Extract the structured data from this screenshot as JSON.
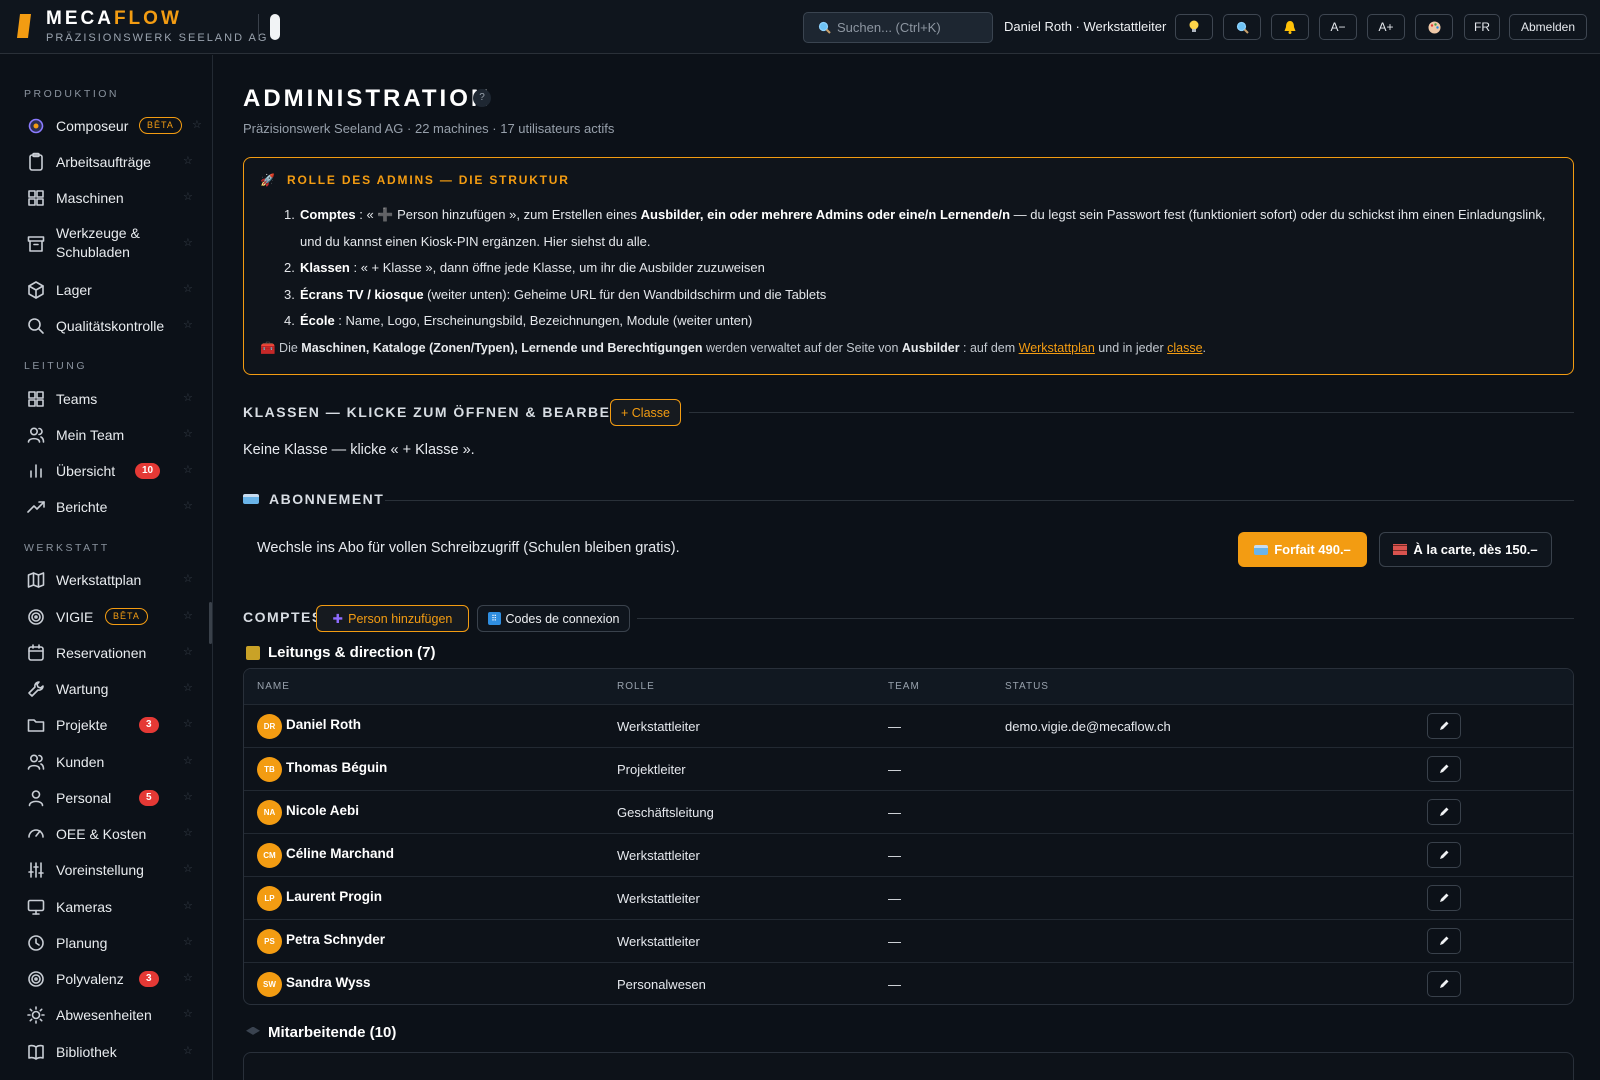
{
  "app": {
    "brand_a": "MECA",
    "brand_b": "FLOW",
    "subtitle": "PRÄZISIONSWERK SEELAND AG",
    "accent": "#f39c12"
  },
  "topbar": {
    "search_placeholder": "Suchen...  (Ctrl+K)",
    "user": "Daniel Roth · Werkstattleiter",
    "buttons": {
      "font_smaller": "A−",
      "font_larger": "A+",
      "lang": "FR",
      "logout": "Abmelden"
    }
  },
  "sidebar": {
    "sections": [
      "PRODUKTION",
      "LEITUNG",
      "WERKSTATT"
    ],
    "items": [
      {
        "label": "Composeur",
        "icon": "composer-icon",
        "badge": "BÊTA"
      },
      {
        "label": "Arbeitsaufträge",
        "icon": "clipboard-icon"
      },
      {
        "label": "Maschinen",
        "icon": "grid-icon"
      },
      {
        "label": "Werkzeuge &",
        "label2": "Schubladen",
        "icon": "archive-icon"
      },
      {
        "label": "Lager",
        "icon": "box-icon"
      },
      {
        "label": "Qualitätskontrolle",
        "icon": "search-icon"
      },
      {
        "label": "Teams",
        "icon": "grid-icon"
      },
      {
        "label": "Mein Team",
        "icon": "users-icon"
      },
      {
        "label": "Übersicht",
        "icon": "bar-chart-icon",
        "count": "10"
      },
      {
        "label": "Berichte",
        "icon": "trend-icon"
      },
      {
        "label": "Werkstattplan",
        "icon": "map-icon"
      },
      {
        "label": "VIGIE",
        "icon": "target-icon",
        "badge": "BÊTA"
      },
      {
        "label": "Reservationen",
        "icon": "calendar-icon"
      },
      {
        "label": "Wartung",
        "icon": "wrench-icon"
      },
      {
        "label": "Projekte",
        "icon": "folder-icon",
        "count": "3"
      },
      {
        "label": "Kunden",
        "icon": "users-icon"
      },
      {
        "label": "Personal",
        "icon": "user-icon",
        "count": "5"
      },
      {
        "label": "OEE & Kosten",
        "icon": "gauge-icon"
      },
      {
        "label": "Voreinstellung",
        "icon": "sliders-icon"
      },
      {
        "label": "Kameras",
        "icon": "monitor-icon"
      },
      {
        "label": "Planung",
        "icon": "clock-icon"
      },
      {
        "label": "Polyvalenz",
        "icon": "target-icon",
        "count": "3"
      },
      {
        "label": "Abwesenheiten",
        "icon": "sun-icon"
      },
      {
        "label": "Bibliothek",
        "icon": "book-icon"
      }
    ]
  },
  "page": {
    "title": "ADMINISTRATION",
    "help": "?",
    "subtitle": "Präzisionswerk Seeland AG · 22 machines · 17 utilisateurs actifs"
  },
  "info": {
    "title": "ROLLE DES ADMINS — DIE STRUKTUR",
    "items": [
      {
        "num": "1.",
        "b1": "Comptes",
        "t1": " : « ",
        "plus": "➕",
        "t2": " Person hinzufügen », zum Erstellen eines ",
        "b2": "Ausbilder, ein oder mehrere Admins oder eine/n Lernende/n",
        "t3": " — du legst sein Passwort fest (funktioniert sofort) oder du schickst ihm einen Einladungslink, und du kannst einen Kiosk-PIN ergänzen. Hier siehst du alle."
      },
      {
        "num": "2.",
        "b1": "Klassen",
        "t1": " : « + Klasse », dann öffne jede Klasse, um ihr die Ausbilder zuzuweisen"
      },
      {
        "num": "3.",
        "b1": "Écrans TV / kiosque",
        "t1": " (weiter unten): Geheime URL für den Wandbildschirm und die Tablets"
      },
      {
        "num": "4.",
        "b1": "École",
        "t1": " : Name, Logo, Erscheinungsbild, Bezeichnungen, Module (weiter unten)"
      }
    ],
    "foot": {
      "t1": " Die ",
      "b1": "Maschinen, Kataloge (Zonen/Typen), Lernende und Berechtigungen",
      "t2": " werden verwaltet auf der Seite von ",
      "b2": "Ausbilder",
      "t3": " : auf dem ",
      "link1": "Werkstattplan",
      "t4": " und in jeder ",
      "link2": "classe",
      "t5": "."
    }
  },
  "klassen": {
    "heading": "KLASSEN — KLICKE ZUM ÖFFNEN & BEARBEITEN",
    "add": "+ Classe",
    "empty": "Keine Klasse — klicke « + Klasse »."
  },
  "abo": {
    "heading": "ABONNEMENT",
    "text": "Wechsle ins Abo für vollen Schreibzugriff (Schulen bleiben gratis).",
    "primary": "Forfait 490.–",
    "secondary": "À la carte, dès 150.–"
  },
  "comptes": {
    "heading": "COMPTES",
    "add": "Person hinzufügen",
    "codes": "Codes de connexion",
    "group1": "Leitungs & direction (7)",
    "group2": "Mitarbeitende (10)",
    "columns": [
      "NAME",
      "ROLLE",
      "TEAM",
      "STATUS"
    ],
    "rows": [
      {
        "initials": "DR",
        "name": "Daniel Roth",
        "role": "Werkstattleiter",
        "team": "—",
        "status": "demo.vigie.de@mecaflow.ch"
      },
      {
        "initials": "TB",
        "name": "Thomas Béguin",
        "role": "Projektleiter",
        "team": "—",
        "status": ""
      },
      {
        "initials": "NA",
        "name": "Nicole Aebi",
        "role": "Geschäftsleitung",
        "team": "—",
        "status": ""
      },
      {
        "initials": "CM",
        "name": "Céline Marchand",
        "role": "Werkstattleiter",
        "team": "—",
        "status": ""
      },
      {
        "initials": "LP",
        "name": "Laurent Progin",
        "role": "Werkstattleiter",
        "team": "—",
        "status": ""
      },
      {
        "initials": "PS",
        "name": "Petra Schnyder",
        "role": "Werkstattleiter",
        "team": "—",
        "status": ""
      },
      {
        "initials": "SW",
        "name": "Sandra Wyss",
        "role": "Personalwesen",
        "team": "—",
        "status": ""
      }
    ]
  }
}
